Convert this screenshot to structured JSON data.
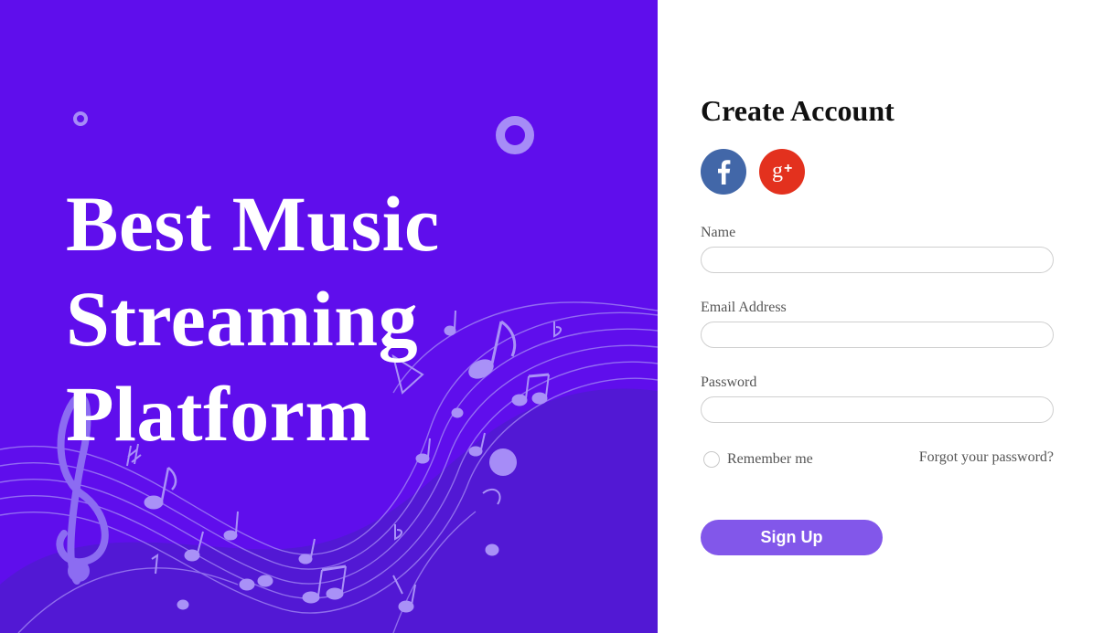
{
  "hero": {
    "title_lines": [
      "Best Music",
      "Streaming",
      "Platform"
    ]
  },
  "form": {
    "title": "Create Account",
    "social": [
      {
        "icon": "facebook-icon",
        "color": "#4267a8"
      },
      {
        "icon": "google-plus-icon",
        "color": "#e3311e"
      }
    ],
    "fields": {
      "name": {
        "label": "Name",
        "value": "",
        "placeholder": ""
      },
      "email": {
        "label": "Email Address",
        "value": "",
        "placeholder": ""
      },
      "password": {
        "label": "Password",
        "value": "",
        "placeholder": ""
      }
    },
    "remember_label": "Remember me",
    "forgot_label": "Forgot your password?",
    "signup_label": "Sign Up"
  },
  "colors": {
    "hero_bg": "#5f0eec",
    "hero_wave": "#5218d4",
    "button": "#8257ea"
  }
}
